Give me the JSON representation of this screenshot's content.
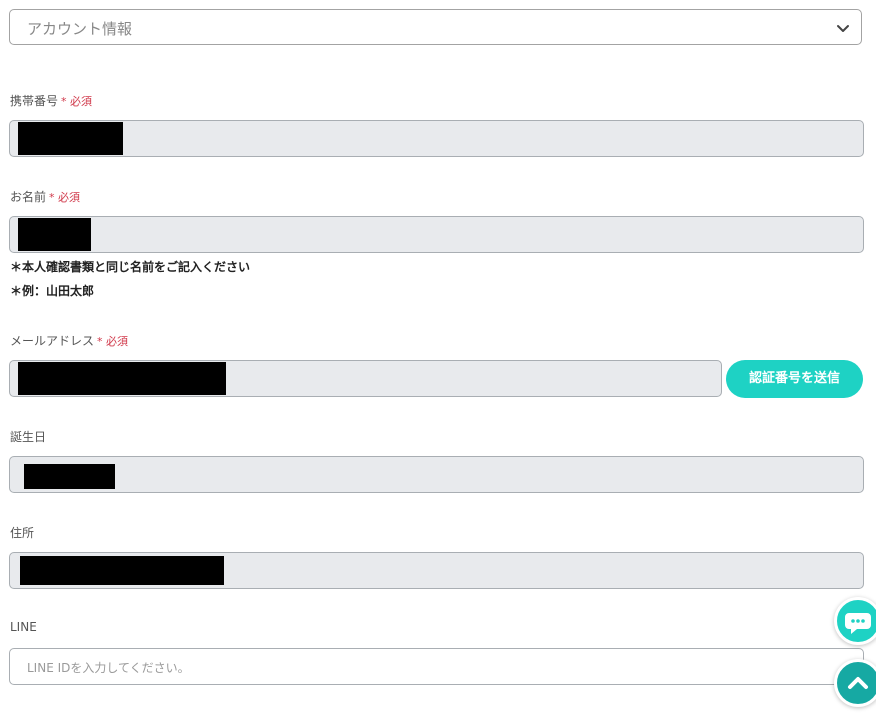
{
  "account_select": {
    "value": "アカウント情報"
  },
  "required_mark": "* 必須",
  "phone": {
    "label": "携帯番号"
  },
  "name": {
    "label": "お名前",
    "notes": [
      "＊本人確認書類と同じ名前をご記入ください",
      "＊例：山田太郎"
    ]
  },
  "email": {
    "label": "メールアドレス",
    "send_button": "認証番号を送信"
  },
  "birthday": {
    "label": "誕生日"
  },
  "address": {
    "label": "住所"
  },
  "line": {
    "label": "LINE",
    "placeholder": "LINE IDを入力してください。"
  },
  "colors": {
    "accent": "#1ed2c4",
    "required": "#d0384a",
    "disabled_field": "#e8eaed"
  },
  "icons": {
    "select_chevron": "chevron-down-icon",
    "chat_fab": "chat-bubble-icon",
    "scroll_top_fab": "chevron-up-icon"
  }
}
